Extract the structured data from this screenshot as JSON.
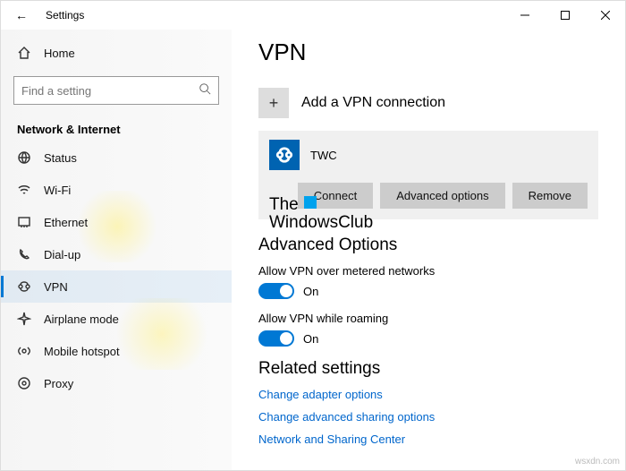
{
  "window": {
    "title": "Settings"
  },
  "sidebar": {
    "home": "Home",
    "search_placeholder": "Find a setting",
    "section": "Network & Internet",
    "items": [
      {
        "label": "Status"
      },
      {
        "label": "Wi-Fi"
      },
      {
        "label": "Ethernet"
      },
      {
        "label": "Dial-up"
      },
      {
        "label": "VPN"
      },
      {
        "label": "Airplane mode"
      },
      {
        "label": "Mobile hotspot"
      },
      {
        "label": "Proxy"
      }
    ]
  },
  "page": {
    "title": "VPN",
    "add_label": "Add a VPN connection",
    "connection": {
      "name": "TWC",
      "actions": {
        "connect": "Connect",
        "advanced": "Advanced options",
        "remove": "Remove"
      }
    },
    "advanced": {
      "heading": "Advanced Options",
      "metered": {
        "label": "Allow VPN over metered networks",
        "state": "On"
      },
      "roaming": {
        "label": "Allow VPN while roaming",
        "state": "On"
      }
    },
    "related": {
      "heading": "Related settings",
      "links": [
        "Change adapter options",
        "Change advanced sharing options",
        "Network and Sharing Center"
      ]
    }
  },
  "watermark": {
    "line1": "The",
    "line2": "WindowsClub"
  },
  "siteref": "wsxdn.com"
}
